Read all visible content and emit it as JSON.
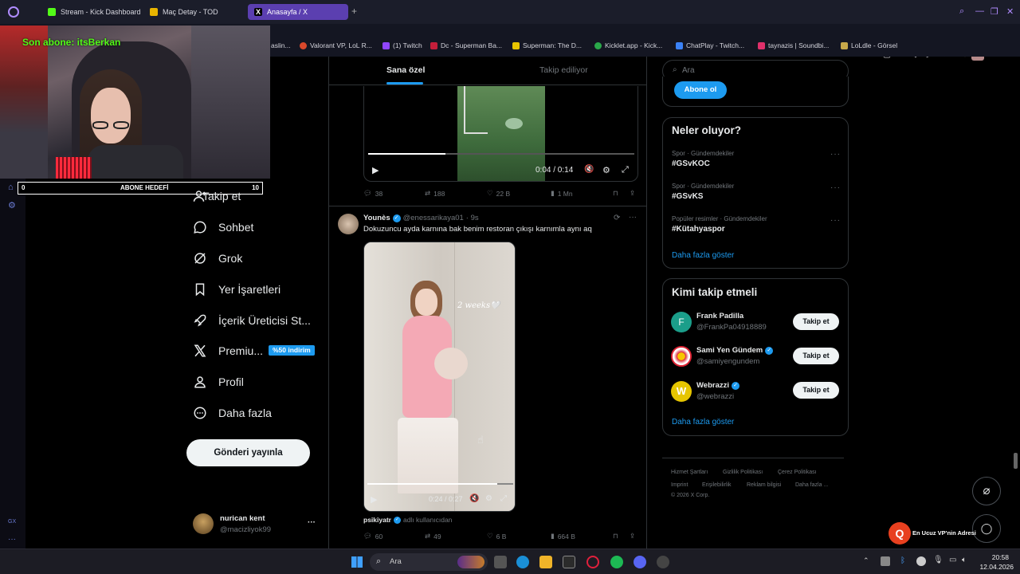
{
  "browser": {
    "tabs": [
      {
        "label": "Stream - Kick Dashboard",
        "color": "#53fc18"
      },
      {
        "label": "Maç Detay - TOD",
        "color": "#e8b400"
      },
      {
        "label": "Anasayfa / X",
        "color": "#ffffff"
      }
    ],
    "new_tab": "+",
    "bookmarks": [
      {
        "label": "aslin...",
        "color": "#888888"
      },
      {
        "label": "Valorant VP, LoL R...",
        "color": "#d9482b"
      },
      {
        "label": "(1) Twitch",
        "color": "#9146ff"
      },
      {
        "label": "Dc - Superman Ba...",
        "color": "#c41e3a"
      },
      {
        "label": "Superman: The D...",
        "color": "#e8c400"
      },
      {
        "label": "Kicklet.app - Kick...",
        "color": "#2aa84a"
      },
      {
        "label": "ChatPlay - Twitch...",
        "color": "#3b82f6"
      },
      {
        "label": "taynazis | Soundbi...",
        "color": "#e0306b"
      },
      {
        "label": "LoLdle - Görsel",
        "color": "#c7a84a"
      }
    ]
  },
  "stream_overlay": {
    "last_sub": "Son abone: itsBerkan",
    "goal_label": "ABONE HEDEFİ",
    "goal_current": "0",
    "goal_target": "10"
  },
  "nav": {
    "items": [
      {
        "label": "Takip et",
        "icon": "person-add-icon"
      },
      {
        "label": "Sohbet",
        "icon": "chat-icon"
      },
      {
        "label": "Grok",
        "icon": "grok-icon"
      },
      {
        "label": "Yer İşaretleri",
        "icon": "bookmark-icon"
      },
      {
        "label": "İçerik Üreticisi St...",
        "icon": "rocket-icon"
      },
      {
        "label": "Premiu...",
        "icon": "x-logo-icon"
      },
      {
        "label": "Profil",
        "icon": "profile-icon"
      },
      {
        "label": "Daha fazla",
        "icon": "more-circle-icon"
      }
    ],
    "promo_badge": "%50 indirim",
    "post_button": "Gönderi yayınla",
    "account": {
      "name": "nurican kent",
      "handle": "@macizliyok99",
      "more": "···"
    }
  },
  "feed": {
    "tabs": [
      {
        "label": "Sana özel",
        "active": true
      },
      {
        "label": "Takip ediliyor",
        "active": false
      }
    ],
    "tweet1": {
      "video_time": "0:04 / 0:14",
      "video_progress": 0.29,
      "replies": "38",
      "retweets": "188",
      "likes": "22 B",
      "views": "1 Mn"
    },
    "tweet2": {
      "author": "Younès",
      "handle": "@enessarikaya01",
      "time": "· 9s",
      "text": "Dokuzuncu ayda karnına bak benim restoran çıkışı karnımla aynı aq",
      "video_overlay_text": "2 weeks🤍",
      "video_time": "0:24 / 0:27",
      "video_progress": 0.89,
      "source_name": "psikiyatr",
      "source_suffix": "adlı kullanıcıdan",
      "replies": "60",
      "retweets": "49",
      "likes": "6 B",
      "views": "664 B"
    }
  },
  "right": {
    "search_placeholder": "Ara",
    "subscribe_button": "Abone ol",
    "trends_title": "Neler oluyor?",
    "trends": [
      {
        "category": "Spor · Gündemdekiler",
        "name": "#GSvKOC"
      },
      {
        "category": "Spor · Gündemdekiler",
        "name": "#GSvKS"
      },
      {
        "category": "Popüler resimler · Gündemdekiler",
        "name": "#Kütahyaspor"
      }
    ],
    "trends_more": "Daha fazla göster",
    "who_title": "Kimi takip etmeli",
    "who": [
      {
        "name": "Frank Padilla",
        "handle": "@FrankPa04918889",
        "verified": false,
        "avatar_color": "#1b9e8a",
        "avatar_letter": "F"
      },
      {
        "name": "Sami Yen Gündem",
        "handle": "@samiyengundem",
        "verified": true,
        "avatar_color": "#ffffff",
        "avatar_letter": ""
      },
      {
        "name": "Webrazzi",
        "handle": "@webrazzi",
        "verified": true,
        "avatar_color": "#e6c500",
        "avatar_letter": "W"
      }
    ],
    "follow_label": "Takip et",
    "who_more": "Daha fazla göster",
    "footer": [
      "Hizmet Şartları",
      "Gizlilik Politikası",
      "Çerez Politikası",
      "Imprint",
      "Erişilebilirlik",
      "Reklam bilgisi",
      "Daha fazla ...",
      "© 2026 X Corp."
    ]
  },
  "vpn_ad": "En Ucuz VP'nin Adresi",
  "taskbar": {
    "search_placeholder": "Ara",
    "time": "20:58",
    "date": "12.04.2026"
  },
  "sidebar_small": {
    "label": "GX"
  }
}
